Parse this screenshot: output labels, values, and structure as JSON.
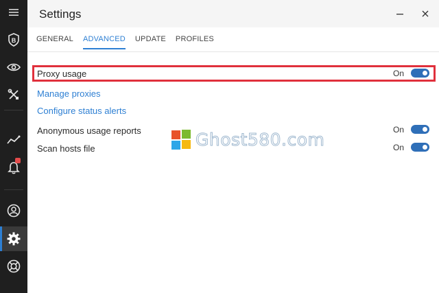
{
  "window": {
    "title": "Settings",
    "minimize_icon": "minimize-icon",
    "close_icon": "close-icon"
  },
  "nav": {
    "items": [
      {
        "icon": "hamburger-menu-icon"
      },
      {
        "icon": "shield-b-icon"
      },
      {
        "icon": "eye-icon"
      },
      {
        "icon": "tools-icon"
      },
      {
        "icon": "activity-chart-icon"
      },
      {
        "icon": "bell-icon",
        "badge": true
      },
      {
        "icon": "account-icon"
      },
      {
        "icon": "gear-icon",
        "active": true
      },
      {
        "icon": "lifebuoy-icon"
      }
    ]
  },
  "tabs": [
    {
      "label": "GENERAL",
      "active": false
    },
    {
      "label": "ADVANCED",
      "active": true
    },
    {
      "label": "UPDATE",
      "active": false
    },
    {
      "label": "PROFILES",
      "active": false
    }
  ],
  "settings": {
    "proxy_usage": {
      "label": "Proxy usage",
      "state": "On",
      "on": true
    },
    "manage_proxies": {
      "label": "Manage proxies"
    },
    "configure_alerts": {
      "label": "Configure status alerts"
    },
    "anonymous_reports": {
      "label": "Anonymous usage reports",
      "state": "On",
      "on": true
    },
    "scan_hosts": {
      "label": "Scan hosts file",
      "state": "On",
      "on": true
    }
  },
  "watermark": {
    "text": "Ghost580.com"
  },
  "colors": {
    "accent": "#2d7fd3",
    "toggle_on": "#2f6fb8",
    "highlight": "#e0303c",
    "rail": "#1f1f1f"
  }
}
